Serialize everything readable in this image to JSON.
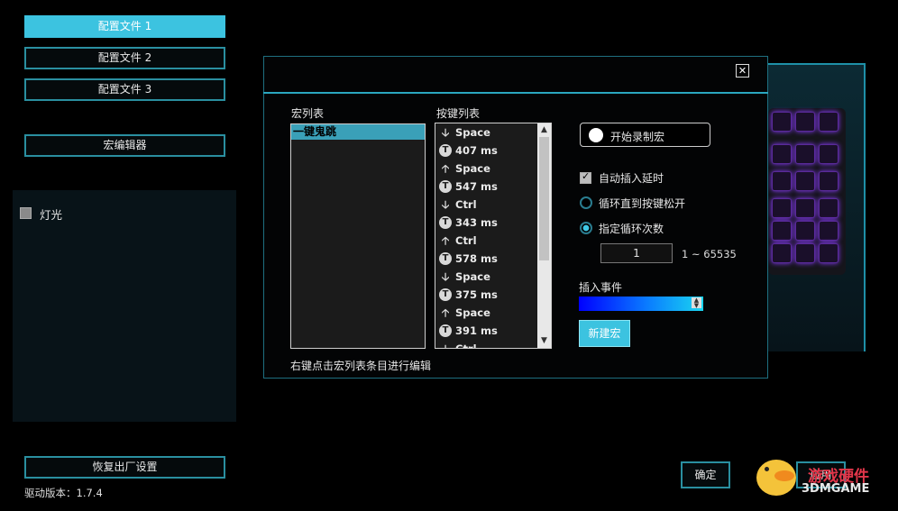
{
  "sidebar": {
    "profiles": [
      "配置文件 1",
      "配置文件 2",
      "配置文件 3"
    ],
    "macro_editor_label": "宏编辑器",
    "light_label": "灯光",
    "reset_label": "恢复出厂设置",
    "version_text": "驱动版本：1.7.4"
  },
  "dialog": {
    "close_symbol": "✕",
    "macro_list_label": "宏列表",
    "macro_items": [
      "一键鬼跳"
    ],
    "key_list_label": "按键列表",
    "key_items": [
      {
        "icon": "down-arrow",
        "text": "Space"
      },
      {
        "icon": "T",
        "text": "407 ms"
      },
      {
        "icon": "up-arrow",
        "text": "Space"
      },
      {
        "icon": "T",
        "text": "547 ms"
      },
      {
        "icon": "down-arrow",
        "text": "Ctrl"
      },
      {
        "icon": "T",
        "text": "343 ms"
      },
      {
        "icon": "up-arrow",
        "text": "Ctrl"
      },
      {
        "icon": "T",
        "text": "578 ms"
      },
      {
        "icon": "down-arrow",
        "text": "Space"
      },
      {
        "icon": "T",
        "text": "375 ms"
      },
      {
        "icon": "up-arrow",
        "text": "Space"
      },
      {
        "icon": "T",
        "text": "391 ms"
      },
      {
        "icon": "down-arrow",
        "text": "Ctrl"
      }
    ],
    "record_label": "开始录制宏",
    "auto_delay_label": "自动插入延时",
    "loop_release_label": "循环直到按键松开",
    "loop_count_label": "指定循环次数",
    "loop_count_value": "1",
    "loop_range": "1 ~ 65535",
    "insert_event_label": "插入事件",
    "new_macro_label": "新建宏",
    "hint": "右键点击宏列表条目进行编辑"
  },
  "footer": {
    "ok_label": "确定",
    "apply_label": "应用"
  },
  "watermark": {
    "text1": "游戏硬件",
    "text2": "3DMGAME"
  },
  "colors": {
    "accent": "#3cc3e0",
    "border": "#2a8fa0"
  }
}
